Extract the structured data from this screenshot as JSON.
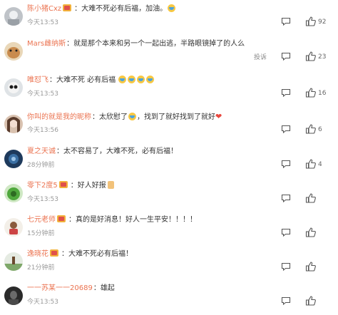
{
  "colors": {
    "username": "#eb7350",
    "text": "#333333",
    "meta": "#999999",
    "heart": "#e8473e"
  },
  "comments": [
    {
      "user": "陈小猪Cxz",
      "text_a": "大难不死必有后福，加油。",
      "text_b": "",
      "extra": "cry-emoji",
      "time": "今天13:53",
      "likes": "92",
      "report": ""
    },
    {
      "user": "Mars雌纳斯",
      "text_a": "就是那个本来和另一个一起出逃，半路眼镜掉了的人么",
      "text_b": "",
      "extra": "",
      "time": "今天13:53",
      "likes": "23",
      "report": "投诉"
    },
    {
      "user": "唯怼飞",
      "text_a": "大难不死 必有后福",
      "text_b": "",
      "extra": "cry-emoji x4",
      "time": "今天13:53",
      "likes": "16",
      "report": ""
    },
    {
      "user": "你叫的就是我的昵称",
      "text_a": "太欣慰了",
      "text_b": "，找到了就好找到了就好",
      "extra": "heart-icon",
      "time": "今天13:56",
      "likes": "6",
      "report": ""
    },
    {
      "user": "夏之天诚",
      "text_a": "太不容易了，大难不死，必有后福！",
      "text_b": "",
      "extra": "",
      "time": "28分钟前",
      "likes": "4",
      "report": ""
    },
    {
      "user": "零下2度5",
      "text_a": "好人好报",
      "text_b": "",
      "extra": "thumb-emoji",
      "time": "今天13:53",
      "likes": "",
      "report": ""
    },
    {
      "user": "七元老师",
      "text_a": "真的是好消息！好人一生平安！！！！",
      "text_b": "",
      "extra": "",
      "time": "15分钟前",
      "likes": "",
      "report": ""
    },
    {
      "user": "逸晓花",
      "text_a": "大难不死必有后福！",
      "text_b": "",
      "extra": "",
      "time": "21分钟前",
      "likes": "",
      "report": ""
    },
    {
      "user": "一一苏某一一20689",
      "text_a": "雄起",
      "text_b": "",
      "extra": "",
      "time": "今天13:53",
      "likes": "",
      "report": ""
    }
  ]
}
